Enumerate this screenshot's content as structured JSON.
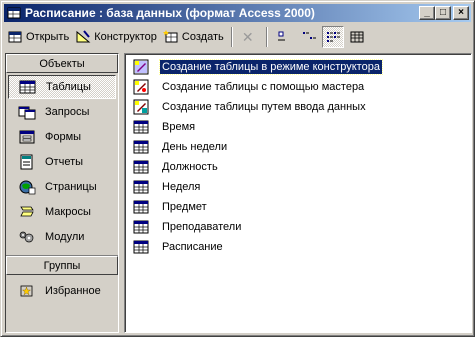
{
  "window": {
    "title": "Расписание : база данных (формат Access 2000)",
    "minimize": "_",
    "maximize": "□",
    "close": "×"
  },
  "toolbar": {
    "open_label": "Открыть",
    "design_label": "Конструктор",
    "create_label": "Создать"
  },
  "sidebar": {
    "objects_header": "Объекты",
    "groups_header": "Группы",
    "items": [
      {
        "label": "Таблицы",
        "icon": "table-icon"
      },
      {
        "label": "Запросы",
        "icon": "query-icon"
      },
      {
        "label": "Формы",
        "icon": "form-icon"
      },
      {
        "label": "Отчеты",
        "icon": "report-icon"
      },
      {
        "label": "Страницы",
        "icon": "page-icon"
      },
      {
        "label": "Макросы",
        "icon": "macro-icon"
      },
      {
        "label": "Модули",
        "icon": "module-icon"
      }
    ],
    "selected": "Таблицы",
    "groups": [
      {
        "label": "Избранное",
        "icon": "favorites-icon"
      }
    ]
  },
  "list": {
    "selected": "Создание таблицы в режиме конструктора",
    "items": [
      {
        "label": "Создание таблицы в режиме конструктора",
        "icon": "design-wizard-icon"
      },
      {
        "label": "Создание таблицы с помощью мастера",
        "icon": "wizard-icon"
      },
      {
        "label": "Создание таблицы путем ввода данных",
        "icon": "datasheet-wizard-icon"
      },
      {
        "label": "Время",
        "icon": "table-icon"
      },
      {
        "label": "День недели",
        "icon": "table-icon"
      },
      {
        "label": "Должность",
        "icon": "table-icon"
      },
      {
        "label": "Неделя",
        "icon": "table-icon"
      },
      {
        "label": "Предмет",
        "icon": "table-icon"
      },
      {
        "label": "Преподаватели",
        "icon": "table-icon"
      },
      {
        "label": "Расписание",
        "icon": "table-icon"
      }
    ]
  },
  "colors": {
    "title_start": "#0a246a",
    "title_end": "#a6caf0",
    "face": "#d4d0c8",
    "selection": "#0a246a"
  }
}
